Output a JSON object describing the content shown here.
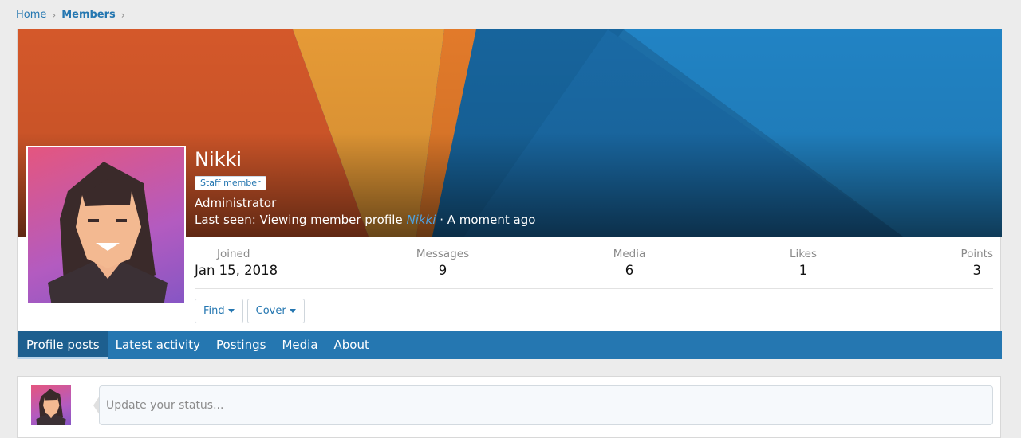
{
  "breadcrumb": {
    "home": "Home",
    "current": "Members"
  },
  "profile": {
    "name": "Nikki",
    "badge": "Staff member",
    "title": "Administrator",
    "last_seen_prefix": "Last seen: Viewing member profile",
    "last_seen_link": "Nikki",
    "last_seen_suffix": "· A moment ago"
  },
  "stats": [
    {
      "label": "Joined",
      "value": "Jan 15, 2018"
    },
    {
      "label": "Messages",
      "value": "9"
    },
    {
      "label": "Media",
      "value": "6"
    },
    {
      "label": "Likes",
      "value": "1"
    },
    {
      "label": "Points",
      "value": "3"
    }
  ],
  "buttons": {
    "find": "Find",
    "cover": "Cover"
  },
  "tabs": [
    {
      "label": "Profile posts",
      "active": true
    },
    {
      "label": "Latest activity",
      "active": false
    },
    {
      "label": "Postings",
      "active": false
    },
    {
      "label": "Media",
      "active": false
    },
    {
      "label": "About",
      "active": false
    }
  ],
  "status": {
    "placeholder": "Update your status..."
  },
  "colors": {
    "accent": "#2577b1",
    "page_background": "#ececec"
  }
}
